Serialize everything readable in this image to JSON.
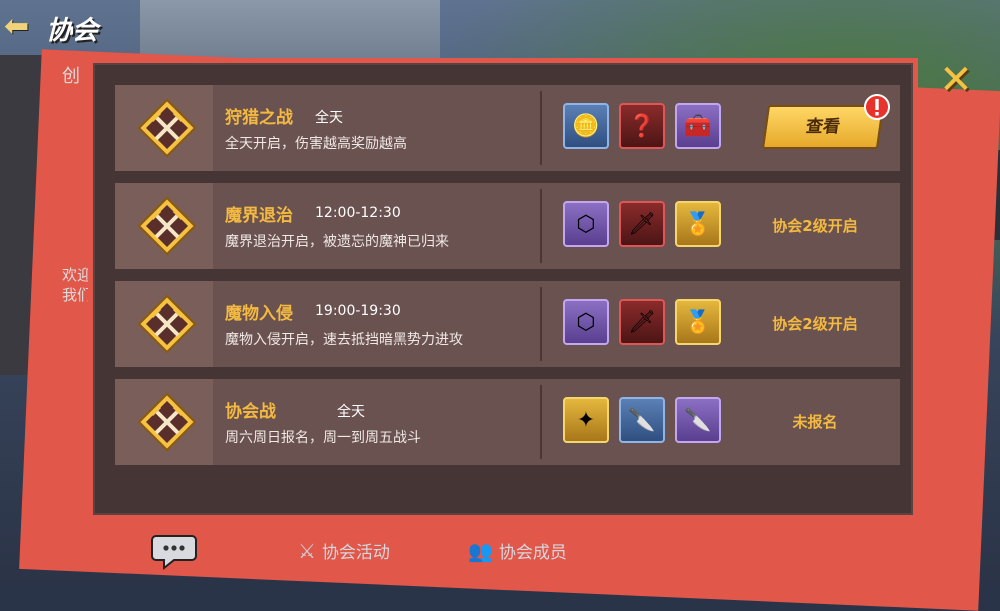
{
  "header": {
    "title": "协会",
    "back_icon": "back-arrow-icon"
  },
  "background": {
    "left_label": "创",
    "left_text": "欢迎我们"
  },
  "close_icon": "close-icon",
  "events": [
    {
      "title": "狩猎之战",
      "time": "全天",
      "description": "全天开启，伤害越高奖励越高",
      "rewards": [
        {
          "icon": "gold-coin-icon",
          "frame": "blue"
        },
        {
          "icon": "mystery-chest-icon",
          "frame": "red"
        },
        {
          "icon": "treasure-chest-icon",
          "frame": "purple"
        }
      ],
      "action": {
        "type": "button",
        "label": "查看",
        "alert": true
      }
    },
    {
      "title": "魔界退治",
      "time": "12:00-12:30",
      "description": "魔界退治开启，被遗忘的魔神已归来",
      "rewards": [
        {
          "icon": "guild-emblem-icon",
          "frame": "purple"
        },
        {
          "icon": "dark-weapons-icon",
          "frame": "red"
        },
        {
          "icon": "gold-medal-icon",
          "frame": "gold"
        }
      ],
      "action": {
        "type": "status",
        "label": "协会2级开启"
      }
    },
    {
      "title": "魔物入侵",
      "time": "19:00-19:30",
      "description": "魔物入侵开启，速去抵挡暗黑势力进攻",
      "rewards": [
        {
          "icon": "guild-emblem-icon",
          "frame": "purple"
        },
        {
          "icon": "dark-weapons-icon",
          "frame": "red"
        },
        {
          "icon": "gold-medal-icon",
          "frame": "gold"
        }
      ],
      "action": {
        "type": "status",
        "label": "协会2级开启"
      }
    },
    {
      "title": "协会战",
      "time": "全天",
      "description": "周六周日报名，周一到周五战斗",
      "rewards": [
        {
          "icon": "jeweled-plate-icon",
          "frame": "gold"
        },
        {
          "icon": "dagger-icon",
          "frame": "blue"
        },
        {
          "icon": "dagger-icon",
          "frame": "purple"
        }
      ],
      "action": {
        "type": "status",
        "label": "未报名"
      }
    }
  ],
  "bottom_tabs": [
    {
      "label": "协会活动",
      "icon": "crossed-swords-icon"
    },
    {
      "label": "协会成员",
      "icon": "members-icon"
    }
  ],
  "colors": {
    "accent": "#f3b940",
    "panel": "#463535",
    "frame": "#e3574a"
  }
}
